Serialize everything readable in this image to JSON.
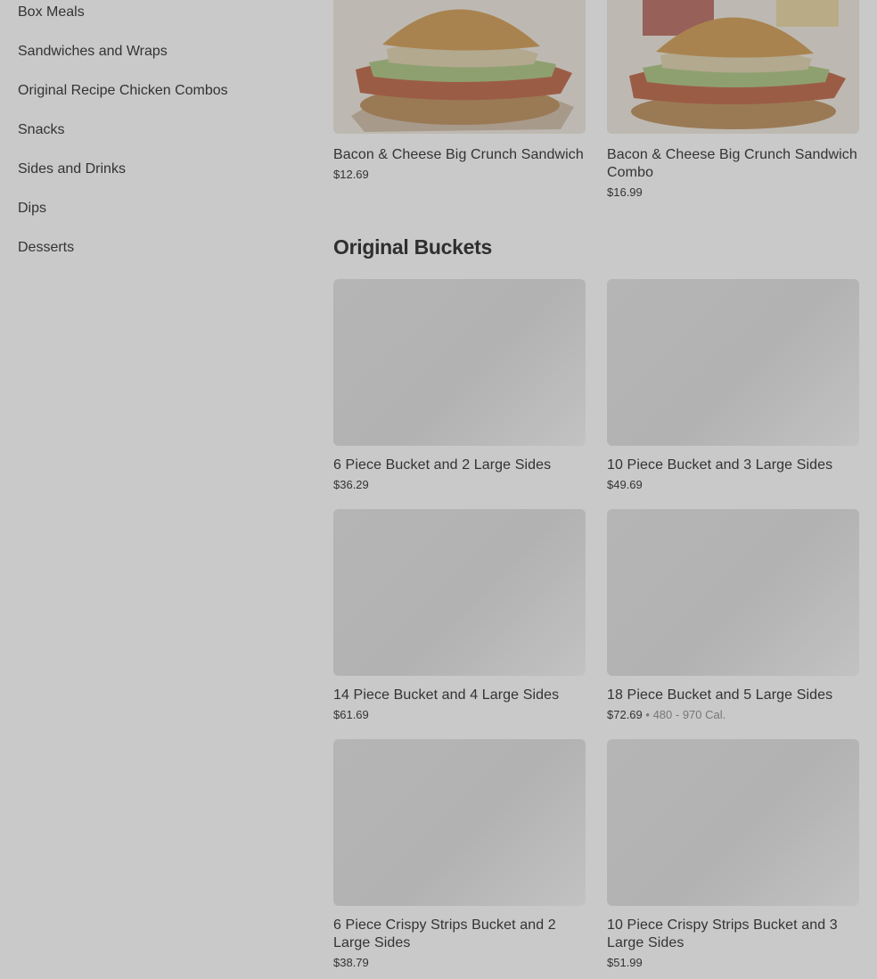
{
  "sidebar": {
    "items": [
      {
        "label": "Box Meals"
      },
      {
        "label": "Sandwiches and Wraps"
      },
      {
        "label": "Original Recipe Chicken Combos"
      },
      {
        "label": "Snacks"
      },
      {
        "label": "Sides and Drinks"
      },
      {
        "label": "Dips"
      },
      {
        "label": "Desserts"
      }
    ]
  },
  "sandwiches": {
    "items": [
      {
        "name": "Bacon & Cheese Big Crunch Sandwich",
        "price": "$12.69"
      },
      {
        "name": "Bacon & Cheese Big Crunch Sandwich Combo",
        "price": "$16.99"
      }
    ]
  },
  "buckets": {
    "title": "Original Buckets",
    "items": [
      {
        "name": "6 Piece Bucket and 2 Large Sides",
        "price": "$36.29"
      },
      {
        "name": "10 Piece Bucket and 3 Large Sides",
        "price": "$49.69"
      },
      {
        "name": "14 Piece Bucket and 4 Large Sides",
        "price": "$61.69"
      },
      {
        "name": "18 Piece Bucket and 5 Large Sides",
        "price": "$72.69",
        "separator": "•",
        "calories": "480 - 970 Cal."
      },
      {
        "name": "6 Piece Crispy Strips Bucket and 2 Large Sides",
        "price": "$38.79"
      },
      {
        "name": "10 Piece Crispy Strips Bucket and 3 Large Sides",
        "price": "$51.99"
      }
    ]
  }
}
